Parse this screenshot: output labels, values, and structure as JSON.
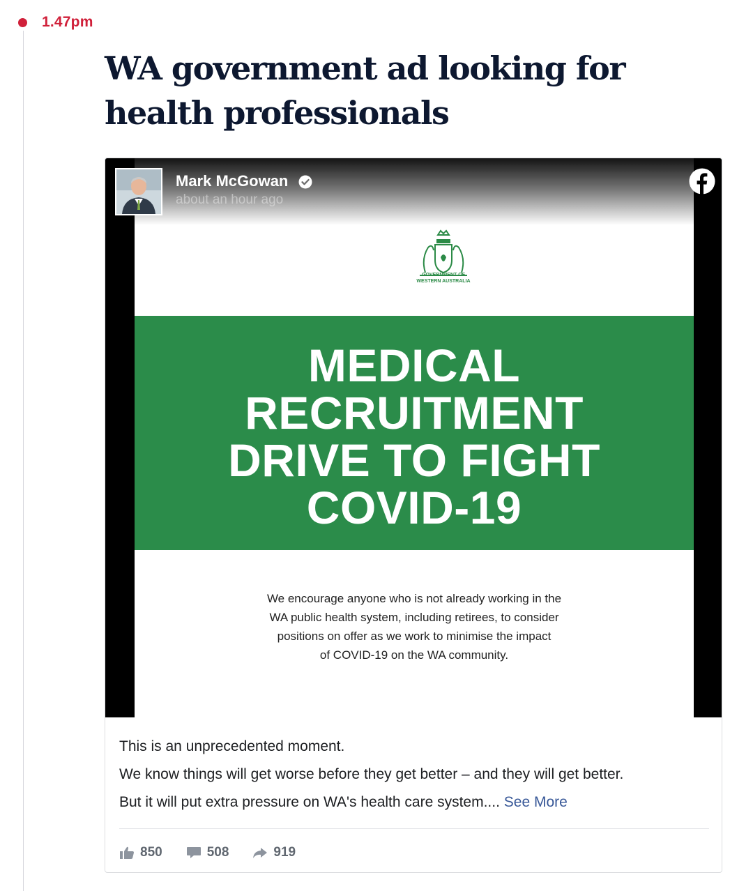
{
  "timeline": {
    "timestamp": "1.47pm",
    "headline": "WA government ad looking for health professionals"
  },
  "post": {
    "author": "Mark McGowan",
    "time_ago": "about an hour ago",
    "platform_icon": "facebook-icon",
    "poster": {
      "crest_caption_line1": "GOVERNMENT OF",
      "crest_caption_line2": "WESTERN AUSTRALIA",
      "banner_lines": [
        "MEDICAL",
        "RECRUITMENT",
        "DRIVE TO FIGHT",
        "COVID-19"
      ],
      "body_lines": [
        "We encourage anyone who is not already working in the",
        "WA public health system, including retirees, to consider",
        "positions on offer as we work to minimise the impact",
        "of COVID-19 on the WA community."
      ]
    },
    "caption_lines": [
      "This is an unprecedented moment.",
      "We know things will get worse before they get better – and they will get better.",
      "But it will put extra pressure on WA's health care system...."
    ],
    "see_more": "See More",
    "stats": {
      "likes": "850",
      "comments": "508",
      "shares": "919"
    }
  },
  "colors": {
    "accent_red": "#d0203a",
    "banner_green": "#2b8c4a",
    "link_blue": "#385898",
    "headline_navy": "#0d1830"
  }
}
